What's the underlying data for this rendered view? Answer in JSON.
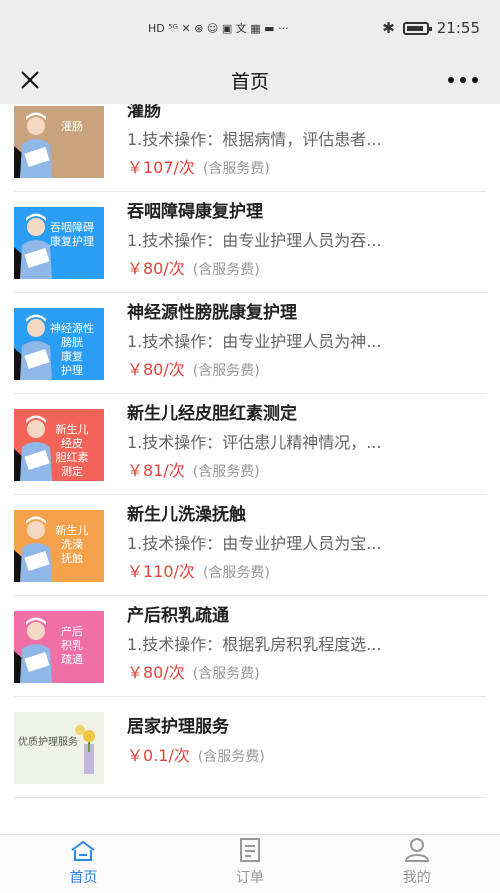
{
  "status_bar": {
    "left_text": "HD ⁵ᴳ ✕ ⊛ ☺ ▣ 文 ▦ ▬ ···",
    "time": "21:55"
  },
  "nav": {
    "title": "首页"
  },
  "items": [
    {
      "title": "灌肠",
      "desc": "1.技术操作：根据病情，评估患者...",
      "price": "￥107/次",
      "note": "(含服务费)",
      "thumb_label": "灌肠",
      "thumb_color": "#c9a27e"
    },
    {
      "title": "吞咽障碍康复护理",
      "desc": "1.技术操作：由专业护理人员为吞...",
      "price": "￥80/次",
      "note": "(含服务费)",
      "thumb_label": "吞咽障碍\n康复护理",
      "thumb_color": "#2a9df4"
    },
    {
      "title": "神经源性膀胱康复护理",
      "desc": "1.技术操作：由专业护理人员为神...",
      "price": "￥80/次",
      "note": "(含服务费)",
      "thumb_label": "神经源性\n膀胱\n康复\n护理",
      "thumb_color": "#2a9df4"
    },
    {
      "title": "新生儿经皮胆红素测定",
      "desc": "1.技术操作：评估患儿精神情况，...",
      "price": "￥81/次",
      "note": "(含服务费)",
      "thumb_label": "新生儿\n经皮\n胆红素\n测定",
      "thumb_color": "#f2645a"
    },
    {
      "title": "新生儿洗澡抚触",
      "desc": "1.技术操作：由专业护理人员为宝...",
      "price": "￥110/次",
      "note": "(含服务费)",
      "thumb_label": "新生儿\n洗澡\n抚触",
      "thumb_color": "#f5a04a"
    },
    {
      "title": "产后积乳疏通",
      "desc": "1.技术操作：根据乳房积乳程度选...",
      "price": "￥80/次",
      "note": "(含服务费)",
      "thumb_label": "产后\n积乳\n疏通",
      "thumb_color": "#ef6fa6"
    },
    {
      "title": "居家护理服务",
      "desc": "",
      "price": "￥0.1/次",
      "note": "(含服务费)",
      "thumb_label": "优质护理服务",
      "thumb_color": "#eef3e6"
    }
  ],
  "tabs": [
    {
      "label": "首页",
      "active": true
    },
    {
      "label": "订单",
      "active": false
    },
    {
      "label": "我的",
      "active": false
    }
  ],
  "colors": {
    "accent": "#2f86e6",
    "price": "#e0443e"
  }
}
